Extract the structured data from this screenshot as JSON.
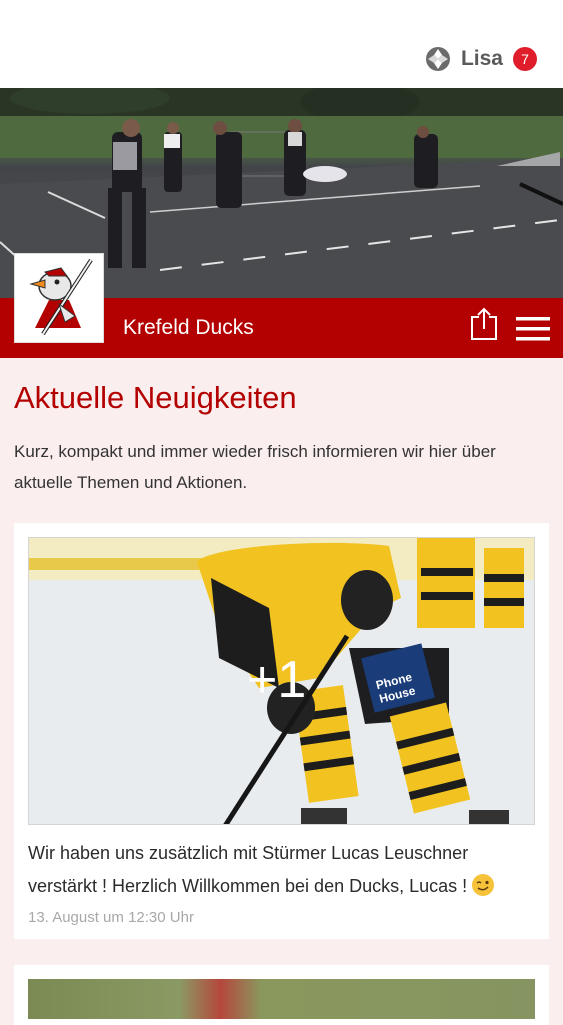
{
  "header": {
    "user_name": "Lisa",
    "notification_count": "7",
    "accent": "#e01e2b"
  },
  "club": {
    "name": "Krefeld Ducks",
    "banner_color": "#b30000"
  },
  "icons": {
    "share": "share-icon",
    "menu": "hamburger-menu-icon",
    "app_logo": "app-logo-icon"
  },
  "news": {
    "title": "Aktuelle Neuigkeiten",
    "description": "Kurz, kompakt und immer wieder frisch informieren wir hier über aktuelle Themen und Aktionen.",
    "items": [
      {
        "image_overlay": "+1",
        "text": "Wir haben uns zusätzlich mit Stürmer Lucas Leuschner verstärkt ! Herzlich Willkommen bei den Ducks, Lucas ! ",
        "date": "13. August um 12:30 Uhr"
      }
    ]
  }
}
